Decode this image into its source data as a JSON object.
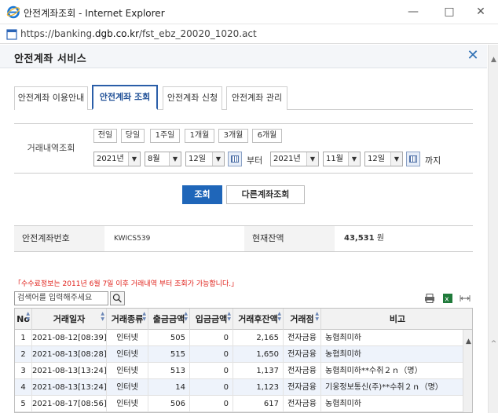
{
  "window": {
    "title": "안전계좌조회 - Internet Explorer",
    "url_prefix": "https://banking.",
    "url_domain": "dgb.co.kr",
    "url_path": "/fst_ebz_20020_1020.act"
  },
  "popup": {
    "title": "안전계좌 서비스"
  },
  "tabs": [
    {
      "label": "안전계좌 이용안내"
    },
    {
      "label": "안전계좌 조회"
    },
    {
      "label": "안전계좌 신청"
    },
    {
      "label": "안전계좌 관리"
    }
  ],
  "search": {
    "label": "거래내역조회",
    "quick_periods": [
      "전일",
      "당일",
      "1주일",
      "1개월",
      "3개월",
      "6개월"
    ],
    "from": {
      "year": "2021년",
      "month": "8월",
      "day": "12일"
    },
    "from_suffix": "부터",
    "to": {
      "year": "2021년",
      "month": "11월",
      "day": "12일"
    },
    "to_suffix": "까지"
  },
  "buttons": {
    "search": "조회",
    "other_account": "다른계좌조회"
  },
  "account": {
    "number_label": "안전계좌번호",
    "number_value": "KWICS539",
    "balance_label": "현재잔액",
    "balance_value": "43,531",
    "balance_unit": "원"
  },
  "notice": "「수수료정보는 2011년 6월 7일 이후 거래내역 부터 조회가 가능합니다.」",
  "grid": {
    "search_placeholder": "검색어를 입력해주세요",
    "columns": [
      "No",
      "거래일자",
      "거래종류",
      "출금금액",
      "입금금액",
      "거래후잔액",
      "거래점",
      "비고"
    ],
    "rows": [
      [
        "1",
        "2021-08-12[08:39]",
        "인터넷",
        "505",
        "0",
        "2,165",
        "전자금융",
        "농협최미하"
      ],
      [
        "2",
        "2021-08-13[08:28]",
        "인터넷",
        "515",
        "0",
        "1,650",
        "전자금융",
        "농협최미하"
      ],
      [
        "3",
        "2021-08-13[13:24]",
        "인터넷",
        "513",
        "0",
        "1,137",
        "전자금융",
        "농협최미하**수취２ｎ（명）"
      ],
      [
        "4",
        "2021-08-13[13:24]",
        "인터넷",
        "14",
        "0",
        "1,123",
        "전자금융",
        "기웅정보통신(주)**수취２ｎ（명）"
      ],
      [
        "5",
        "2021-08-17[08:56]",
        "인터넷",
        "506",
        "0",
        "617",
        "전자금융",
        "농협최미하"
      ]
    ]
  },
  "colors": {
    "accent": "#1f66b9",
    "tab_active": "#2a5ea8",
    "notice": "#e0201a",
    "row_alt": "#eef3fb"
  }
}
